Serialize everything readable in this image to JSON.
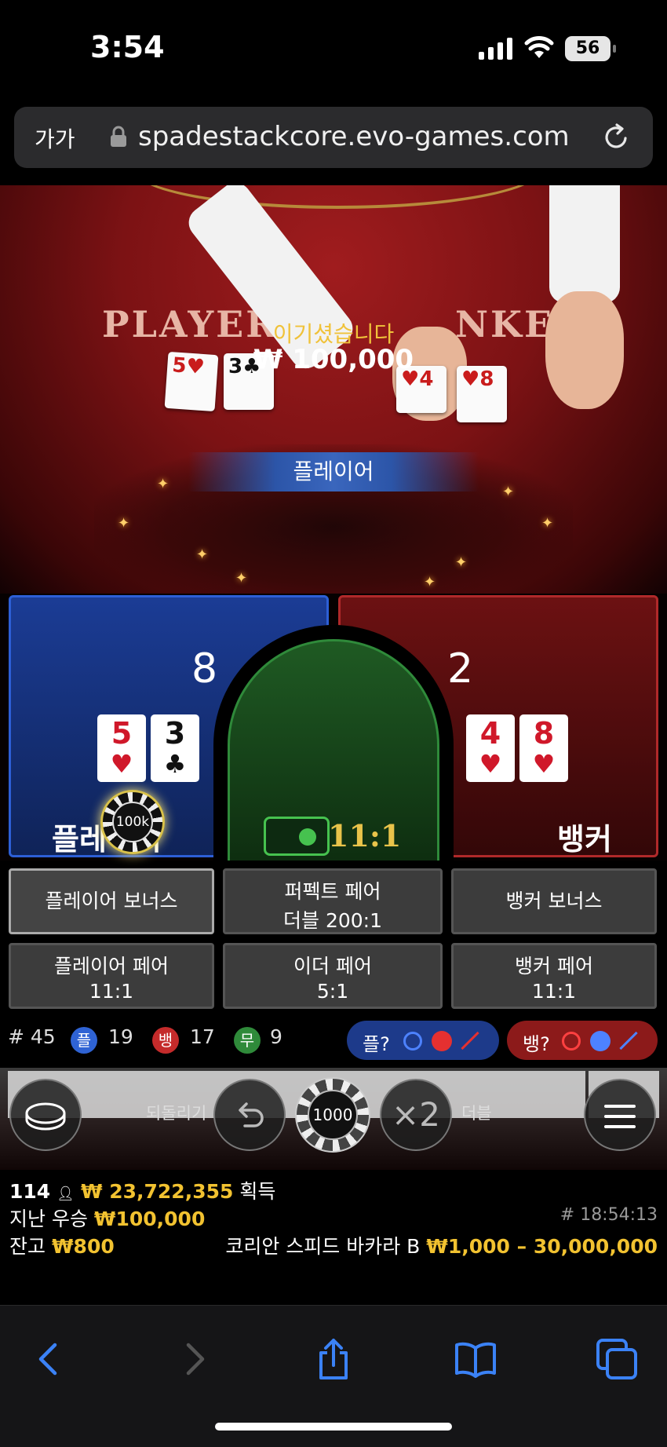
{
  "status_bar": {
    "time": "3:54",
    "battery": "56"
  },
  "browser": {
    "text_size_label": "가가",
    "url": "spadestackcore.evo-games.com"
  },
  "video": {
    "felt_player": "PLAYER",
    "felt_banker": "NKER",
    "cards_player": [
      {
        "rank": "5",
        "suit": "♥",
        "color": "red"
      },
      {
        "rank": "3",
        "suit": "♣",
        "color": "black"
      }
    ],
    "cards_banker": [
      {
        "rank": "4",
        "suit": "♥",
        "color": "red"
      },
      {
        "rank": "8",
        "suit": "♥",
        "color": "red"
      }
    ]
  },
  "result": {
    "winner_label": "플레이어",
    "win_message": "이기셨습니다",
    "win_amount": "₩ 100,000"
  },
  "board": {
    "player_label": "플레이어",
    "banker_label": "뱅커",
    "player_score": "8",
    "banker_score": "2",
    "player_cards": [
      {
        "rank": "5",
        "suit": "♥",
        "color": "red"
      },
      {
        "rank": "3",
        "suit": "♣",
        "color": "black"
      }
    ],
    "banker_cards": [
      {
        "rank": "4",
        "suit": "♥",
        "color": "red"
      },
      {
        "rank": "8",
        "suit": "♥",
        "color": "red"
      }
    ],
    "player_chip": "100k",
    "tie_payout": "11:1",
    "colors": {
      "player": "#2d5fd6",
      "banker": "#b0292a",
      "tie": "#2f8a3a"
    }
  },
  "side_bets": {
    "player_bonus": "플레이어 보너스",
    "perfect_pair_title": "퍼펙트 페어",
    "perfect_pair_payout": "더블 200:1",
    "banker_bonus": "뱅커 보너스",
    "player_pair_title": "플레이어 페어",
    "player_pair_payout": "11:1",
    "either_pair_title": "이더 페어",
    "either_pair_payout": "5:1",
    "banker_pair_title": "뱅커 페어",
    "banker_pair_payout": "11:1"
  },
  "stats": {
    "round_label": "# 45",
    "player_letter": "플",
    "player_count": "19",
    "banker_letter": "뱅",
    "banker_count": "17",
    "tie_letter": "무",
    "tie_count": "9",
    "player_ask": "플?",
    "banker_ask": "뱅?"
  },
  "controls": {
    "undo_label": "되돌리기",
    "chip_value": "1000",
    "double_symbol": "×2",
    "double_label": "더블"
  },
  "info": {
    "players_count": "114",
    "total_won": "₩ 23,722,355",
    "total_won_suffix": "획득",
    "last_win_label": "지난 우승",
    "last_win_amount": "₩100,000",
    "balance_label": "잔고",
    "balance_amount": "₩800",
    "timestamp": "# 18:54:13",
    "table_name": "코리안 스피드 바카라 B",
    "limits": "₩1,000 – 30,000,000"
  }
}
